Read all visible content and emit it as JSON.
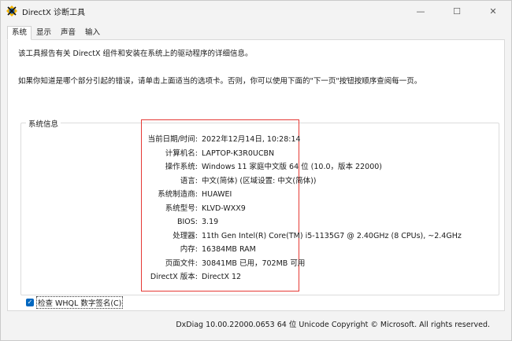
{
  "window": {
    "title": "DirectX 诊断工具",
    "minimize": "—",
    "maximize": "☐",
    "close": "✕"
  },
  "tabs": [
    {
      "label": "系统"
    },
    {
      "label": "显示"
    },
    {
      "label": "声音"
    },
    {
      "label": "输入"
    }
  ],
  "intro": {
    "line1": "该工具报告有关 DirectX 组件和安装在系统上的驱动程序的详细信息。",
    "line2": "如果你知道是哪个部分引起的错误，请单击上面适当的选项卡。否则，你可以使用下面的\"下一页\"按钮按顺序查阅每一页。"
  },
  "system_info": {
    "group_title": "系统信息",
    "rows": [
      {
        "label": "当前日期/时间:",
        "value": "2022年12月14日, 10:28:14"
      },
      {
        "label": "计算机名:",
        "value": "LAPTOP-K3R0UCBN"
      },
      {
        "label": "操作系统:",
        "value": "Windows 11 家庭中文版 64 位 (10.0，版本 22000)"
      },
      {
        "label": "语言:",
        "value": "中文(简体) (区域设置: 中文(简体))"
      },
      {
        "label": "系统制造商:",
        "value": "HUAWEI"
      },
      {
        "label": "系统型号:",
        "value": "KLVD-WXX9"
      },
      {
        "label": "BIOS:",
        "value": "3.19"
      },
      {
        "label": "处理器:",
        "value": "11th Gen Intel(R) Core(TM) i5-1135G7 @ 2.40GHz (8 CPUs), ~2.4GHz"
      },
      {
        "label": "内存:",
        "value": "16384MB RAM"
      },
      {
        "label": "页面文件:",
        "value": "30841MB 已用，702MB 可用"
      },
      {
        "label": "DirectX 版本:",
        "value": "DirectX 12"
      }
    ]
  },
  "whql": {
    "label": "检查 WHQL 数字签名(C)",
    "checked": true
  },
  "footer": {
    "text": "DxDiag 10.00.22000.0653 64 位 Unicode  Copyright © Microsoft. All rights reserved."
  },
  "colors": {
    "highlight_border": "#e53935",
    "checkbox_accent": "#0067c0"
  }
}
